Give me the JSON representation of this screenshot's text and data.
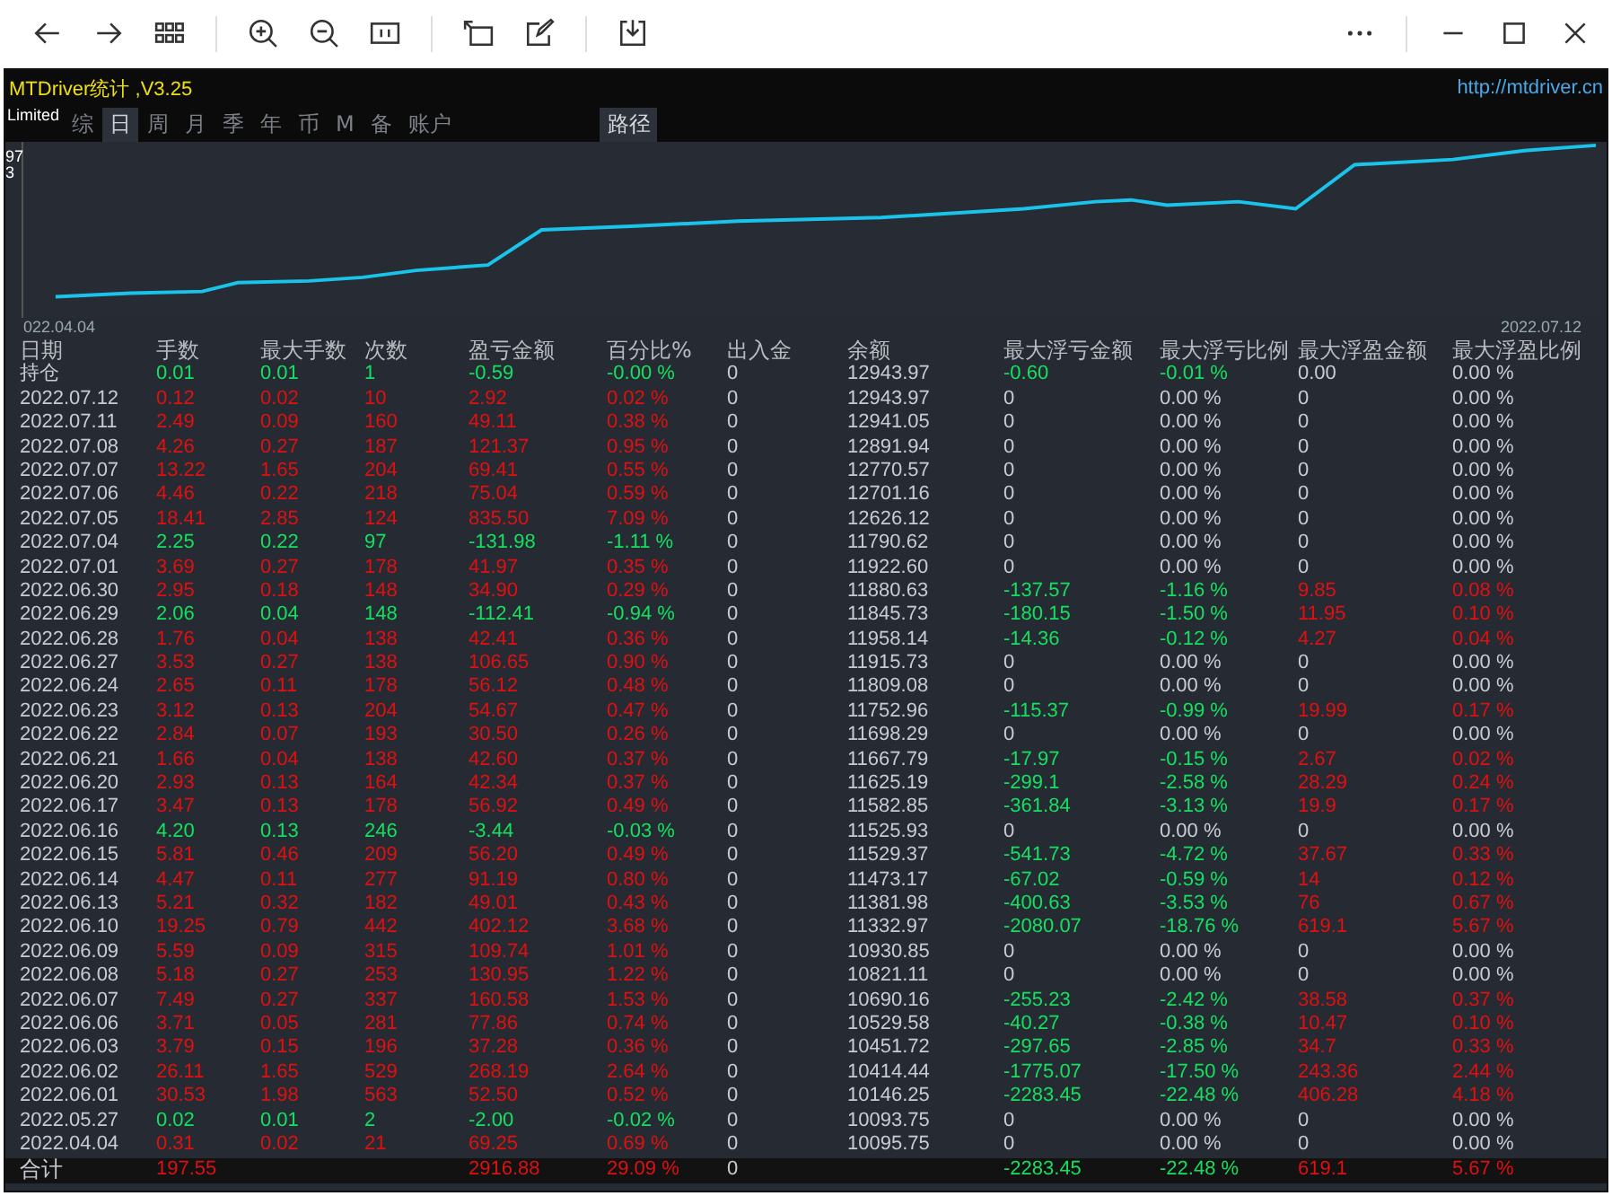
{
  "app": {
    "title": "MTDriver统计 ,V3.25",
    "url": "http://mtdriver.cn",
    "badge": "Limited"
  },
  "tabs": [
    {
      "label": "综",
      "selected": false
    },
    {
      "label": "日",
      "selected": true
    },
    {
      "label": "周",
      "selected": false
    },
    {
      "label": "月",
      "selected": false
    },
    {
      "label": "季",
      "selected": false
    },
    {
      "label": "年",
      "selected": false
    },
    {
      "label": "币",
      "selected": false
    },
    {
      "label": "M",
      "selected": false
    },
    {
      "label": "备",
      "selected": false
    },
    {
      "label": "账户",
      "selected": false
    }
  ],
  "path_button": "路径",
  "chart": {
    "y_labels": [
      "97",
      "3"
    ],
    "x_start": "022.04.04",
    "x_end": "2022.07.12"
  },
  "table": {
    "columns": [
      "日期",
      "手数",
      "最大手数",
      "次数",
      "盈亏金额",
      "百分比%",
      "出入金",
      "余额",
      "最大浮亏金额",
      "最大浮亏比例",
      "最大浮盈金额",
      "最大浮盈比例"
    ],
    "rows": [
      {
        "gain": false,
        "float_loss": true,
        "float_profit": false,
        "cells": [
          "持仓",
          "0.01",
          "0.01",
          "1",
          "-0.59",
          "-0.00 %",
          "0",
          "12943.97",
          "-0.60",
          "-0.01 %",
          "0.00",
          "0.00 %"
        ]
      },
      {
        "gain": true,
        "float_loss": false,
        "float_profit": false,
        "cells": [
          "2022.07.12",
          "0.12",
          "0.02",
          "10",
          "2.92",
          "0.02 %",
          "0",
          "12943.97",
          "0",
          "0.00 %",
          "0",
          "0.00 %"
        ]
      },
      {
        "gain": true,
        "float_loss": false,
        "float_profit": false,
        "cells": [
          "2022.07.11",
          "2.49",
          "0.09",
          "160",
          "49.11",
          "0.38 %",
          "0",
          "12941.05",
          "0",
          "0.00 %",
          "0",
          "0.00 %"
        ]
      },
      {
        "gain": true,
        "float_loss": false,
        "float_profit": false,
        "cells": [
          "2022.07.08",
          "4.26",
          "0.27",
          "187",
          "121.37",
          "0.95 %",
          "0",
          "12891.94",
          "0",
          "0.00 %",
          "0",
          "0.00 %"
        ]
      },
      {
        "gain": true,
        "float_loss": false,
        "float_profit": false,
        "cells": [
          "2022.07.07",
          "13.22",
          "1.65",
          "204",
          "69.41",
          "0.55 %",
          "0",
          "12770.57",
          "0",
          "0.00 %",
          "0",
          "0.00 %"
        ]
      },
      {
        "gain": true,
        "float_loss": false,
        "float_profit": false,
        "cells": [
          "2022.07.06",
          "4.46",
          "0.22",
          "218",
          "75.04",
          "0.59 %",
          "0",
          "12701.16",
          "0",
          "0.00 %",
          "0",
          "0.00 %"
        ]
      },
      {
        "gain": true,
        "float_loss": false,
        "float_profit": false,
        "cells": [
          "2022.07.05",
          "18.41",
          "2.85",
          "124",
          "835.50",
          "7.09 %",
          "0",
          "12626.12",
          "0",
          "0.00 %",
          "0",
          "0.00 %"
        ]
      },
      {
        "gain": false,
        "float_loss": false,
        "float_profit": false,
        "cells": [
          "2022.07.04",
          "2.25",
          "0.22",
          "97",
          "-131.98",
          "-1.11 %",
          "0",
          "11790.62",
          "0",
          "0.00 %",
          "0",
          "0.00 %"
        ]
      },
      {
        "gain": true,
        "float_loss": false,
        "float_profit": false,
        "cells": [
          "2022.07.01",
          "3.69",
          "0.27",
          "178",
          "41.97",
          "0.35 %",
          "0",
          "11922.60",
          "0",
          "0.00 %",
          "0",
          "0.00 %"
        ]
      },
      {
        "gain": true,
        "float_loss": true,
        "float_profit": true,
        "cells": [
          "2022.06.30",
          "2.95",
          "0.18",
          "148",
          "34.90",
          "0.29 %",
          "0",
          "11880.63",
          "-137.57",
          "-1.16 %",
          "9.85",
          "0.08 %"
        ]
      },
      {
        "gain": false,
        "float_loss": true,
        "float_profit": true,
        "cells": [
          "2022.06.29",
          "2.06",
          "0.04",
          "148",
          "-112.41",
          "-0.94 %",
          "0",
          "11845.73",
          "-180.15",
          "-1.50 %",
          "11.95",
          "0.10 %"
        ]
      },
      {
        "gain": true,
        "float_loss": true,
        "float_profit": true,
        "cells": [
          "2022.06.28",
          "1.76",
          "0.04",
          "138",
          "42.41",
          "0.36 %",
          "0",
          "11958.14",
          "-14.36",
          "-0.12 %",
          "4.27",
          "0.04 %"
        ]
      },
      {
        "gain": true,
        "float_loss": false,
        "float_profit": false,
        "cells": [
          "2022.06.27",
          "3.53",
          "0.27",
          "138",
          "106.65",
          "0.90 %",
          "0",
          "11915.73",
          "0",
          "0.00 %",
          "0",
          "0.00 %"
        ]
      },
      {
        "gain": true,
        "float_loss": false,
        "float_profit": false,
        "cells": [
          "2022.06.24",
          "2.65",
          "0.11",
          "178",
          "56.12",
          "0.48 %",
          "0",
          "11809.08",
          "0",
          "0.00 %",
          "0",
          "0.00 %"
        ]
      },
      {
        "gain": true,
        "float_loss": true,
        "float_profit": true,
        "cells": [
          "2022.06.23",
          "3.12",
          "0.13",
          "204",
          "54.67",
          "0.47 %",
          "0",
          "11752.96",
          "-115.37",
          "-0.99 %",
          "19.99",
          "0.17 %"
        ]
      },
      {
        "gain": true,
        "float_loss": false,
        "float_profit": false,
        "cells": [
          "2022.06.22",
          "2.84",
          "0.07",
          "193",
          "30.50",
          "0.26 %",
          "0",
          "11698.29",
          "0",
          "0.00 %",
          "0",
          "0.00 %"
        ]
      },
      {
        "gain": true,
        "float_loss": true,
        "float_profit": true,
        "cells": [
          "2022.06.21",
          "1.66",
          "0.04",
          "138",
          "42.60",
          "0.37 %",
          "0",
          "11667.79",
          "-17.97",
          "-0.15 %",
          "2.67",
          "0.02 %"
        ]
      },
      {
        "gain": true,
        "float_loss": true,
        "float_profit": true,
        "cells": [
          "2022.06.20",
          "2.93",
          "0.13",
          "164",
          "42.34",
          "0.37 %",
          "0",
          "11625.19",
          "-299.1",
          "-2.58 %",
          "28.29",
          "0.24 %"
        ]
      },
      {
        "gain": true,
        "float_loss": true,
        "float_profit": true,
        "cells": [
          "2022.06.17",
          "3.47",
          "0.13",
          "178",
          "56.92",
          "0.49 %",
          "0",
          "11582.85",
          "-361.84",
          "-3.13 %",
          "19.9",
          "0.17 %"
        ]
      },
      {
        "gain": false,
        "float_loss": false,
        "float_profit": false,
        "cells": [
          "2022.06.16",
          "4.20",
          "0.13",
          "246",
          "-3.44",
          "-0.03 %",
          "0",
          "11525.93",
          "0",
          "0.00 %",
          "0",
          "0.00 %"
        ]
      },
      {
        "gain": true,
        "float_loss": true,
        "float_profit": true,
        "cells": [
          "2022.06.15",
          "5.81",
          "0.46",
          "209",
          "56.20",
          "0.49 %",
          "0",
          "11529.37",
          "-541.73",
          "-4.72 %",
          "37.67",
          "0.33 %"
        ]
      },
      {
        "gain": true,
        "float_loss": true,
        "float_profit": true,
        "cells": [
          "2022.06.14",
          "4.47",
          "0.11",
          "277",
          "91.19",
          "0.80 %",
          "0",
          "11473.17",
          "-67.02",
          "-0.59 %",
          "14",
          "0.12 %"
        ]
      },
      {
        "gain": true,
        "float_loss": true,
        "float_profit": true,
        "cells": [
          "2022.06.13",
          "5.21",
          "0.32",
          "182",
          "49.01",
          "0.43 %",
          "0",
          "11381.98",
          "-400.63",
          "-3.53 %",
          "76",
          "0.67 %"
        ]
      },
      {
        "gain": true,
        "float_loss": true,
        "float_profit": true,
        "cells": [
          "2022.06.10",
          "19.25",
          "0.79",
          "442",
          "402.12",
          "3.68 %",
          "0",
          "11332.97",
          "-2080.07",
          "-18.76 %",
          "619.1",
          "5.67 %"
        ]
      },
      {
        "gain": true,
        "float_loss": false,
        "float_profit": false,
        "cells": [
          "2022.06.09",
          "5.59",
          "0.09",
          "315",
          "109.74",
          "1.01 %",
          "0",
          "10930.85",
          "0",
          "0.00 %",
          "0",
          "0.00 %"
        ]
      },
      {
        "gain": true,
        "float_loss": false,
        "float_profit": false,
        "cells": [
          "2022.06.08",
          "5.18",
          "0.27",
          "253",
          "130.95",
          "1.22 %",
          "0",
          "10821.11",
          "0",
          "0.00 %",
          "0",
          "0.00 %"
        ]
      },
      {
        "gain": true,
        "float_loss": true,
        "float_profit": true,
        "cells": [
          "2022.06.07",
          "7.49",
          "0.27",
          "337",
          "160.58",
          "1.53 %",
          "0",
          "10690.16",
          "-255.23",
          "-2.42 %",
          "38.58",
          "0.37 %"
        ]
      },
      {
        "gain": true,
        "float_loss": true,
        "float_profit": true,
        "cells": [
          "2022.06.06",
          "3.71",
          "0.05",
          "281",
          "77.86",
          "0.74 %",
          "0",
          "10529.58",
          "-40.27",
          "-0.38 %",
          "10.47",
          "0.10 %"
        ]
      },
      {
        "gain": true,
        "float_loss": true,
        "float_profit": true,
        "cells": [
          "2022.06.03",
          "3.79",
          "0.15",
          "196",
          "37.28",
          "0.36 %",
          "0",
          "10451.72",
          "-297.65",
          "-2.85 %",
          "34.7",
          "0.33 %"
        ]
      },
      {
        "gain": true,
        "float_loss": true,
        "float_profit": true,
        "cells": [
          "2022.06.02",
          "26.11",
          "1.65",
          "529",
          "268.19",
          "2.64 %",
          "0",
          "10414.44",
          "-1775.07",
          "-17.50 %",
          "243.36",
          "2.44 %"
        ]
      },
      {
        "gain": true,
        "float_loss": true,
        "float_profit": true,
        "cells": [
          "2022.06.01",
          "30.53",
          "1.98",
          "563",
          "52.50",
          "0.52 %",
          "0",
          "10146.25",
          "-2283.45",
          "-22.48 %",
          "406.28",
          "4.18 %"
        ]
      },
      {
        "gain": false,
        "float_loss": false,
        "float_profit": false,
        "cells": [
          "2022.05.27",
          "0.02",
          "0.01",
          "2",
          "-2.00",
          "-0.02 %",
          "0",
          "10093.75",
          "0",
          "0.00 %",
          "0",
          "0.00 %"
        ]
      },
      {
        "gain": true,
        "float_loss": false,
        "float_profit": false,
        "cells": [
          "2022.04.04",
          "0.31",
          "0.02",
          "21",
          "69.25",
          "0.69 %",
          "0",
          "10095.75",
          "0",
          "0.00 %",
          "0",
          "0.00 %"
        ]
      }
    ],
    "total": {
      "gain": true,
      "float_loss": true,
      "float_profit": true,
      "cells": [
        "合计",
        "197.55",
        "",
        "",
        "2916.88",
        "29.09 %",
        "0",
        "",
        "-2283.45",
        "-22.48 %",
        "619.1",
        "5.67 %"
      ]
    }
  }
}
